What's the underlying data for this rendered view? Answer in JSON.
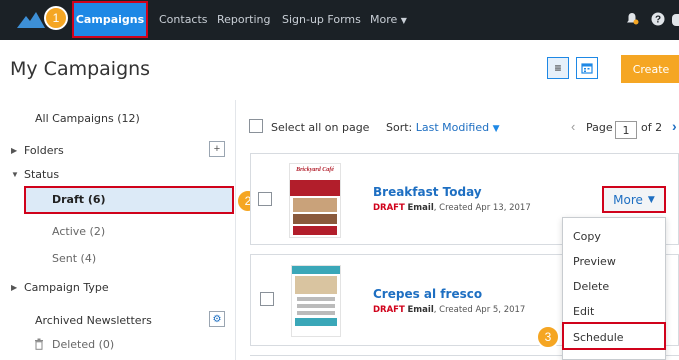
{
  "nav": {
    "items": [
      "Campaigns",
      "Contacts",
      "Reporting",
      "Sign-up Forms",
      "More"
    ],
    "active": "Campaigns",
    "icons": [
      "bell-icon",
      "help-icon"
    ]
  },
  "steps": [
    "1",
    "2",
    "3"
  ],
  "header": {
    "title": "My Campaigns",
    "create_label": "Create"
  },
  "sidebar": {
    "all_campaigns": "All Campaigns (12)",
    "folders": "Folders",
    "status": "Status",
    "draft": "Draft (6)",
    "active": "Active (2)",
    "sent": "Sent (4)",
    "campaign_type": "Campaign Type",
    "archived": "Archived Newsletters",
    "deleted": "Deleted (0)"
  },
  "toolbar": {
    "select_all": "Select all on page",
    "sort_label": "Sort:",
    "sort_value": "Last Modified",
    "page_label": "Page",
    "page_current": "1",
    "page_total": "of 2"
  },
  "campaigns": [
    {
      "name": "Breakfast Today",
      "status": "DRAFT",
      "kind": "Email",
      "created": ", Created Apr 13, 2017"
    },
    {
      "name": "Crepes al fresco",
      "status": "DRAFT",
      "kind": "Email",
      "created": ", Created Apr 5, 2017"
    }
  ],
  "thumb_brand": "Brickyard Café",
  "more_label": "More",
  "menu": [
    "Copy",
    "Preview",
    "Delete",
    "Edit",
    "Schedule"
  ],
  "colors": {
    "nav_bg": "#1b2126",
    "accent": "#1e88e5",
    "highlight": "#d0021b",
    "step_badge": "#f5a623",
    "create": "#f5a623"
  }
}
